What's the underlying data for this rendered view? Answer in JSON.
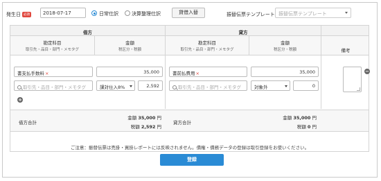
{
  "header": {
    "date_label": "発生日",
    "required_badge": "必須",
    "date_value": "2018-07-17",
    "radio_normal": "日常仕訳",
    "radio_closing": "決算整理仕訳",
    "swap_button": "貸借入替",
    "template_label": "振替伝票テンプレート",
    "template_placeholder": "振替伝票テンプレート"
  },
  "table": {
    "debit_title": "借方",
    "credit_title": "貸方",
    "col_account": "勘定科目",
    "col_account_sub": "取引先・品目・部門・メモタグ",
    "col_amount": "金額",
    "col_amount_sub": "税区分・税額",
    "col_memo": "備考",
    "debit": {
      "account": "書支払手数料",
      "amount": "35,000",
      "tag_placeholder": "取引先・品目・部門・メモタグ",
      "tax_category": "課対仕入8%",
      "tax_amount": "2,592"
    },
    "credit": {
      "account": "書前払費用",
      "amount": "35,000",
      "tag_placeholder": "取引先・品目・部門・メモタグ",
      "tax_category": "対象外",
      "tax_amount": "0"
    },
    "debit_total_label": "借方合計",
    "credit_total_label": "貸方合計",
    "amount_word": "金額",
    "tax_word": "税額",
    "debit_total_amount": "35,000",
    "debit_total_tax": "2,592",
    "credit_total_amount": "35,000",
    "credit_total_tax": "0",
    "yen": "円"
  },
  "notice": "ご注意：振替伝票は売掛・買掛レポートには反映されません。債権・債務データの登録は取引登録をお使いください。",
  "register_button": "登録",
  "colors": {
    "accent": "#2a8bd5",
    "required": "#e0473e"
  }
}
